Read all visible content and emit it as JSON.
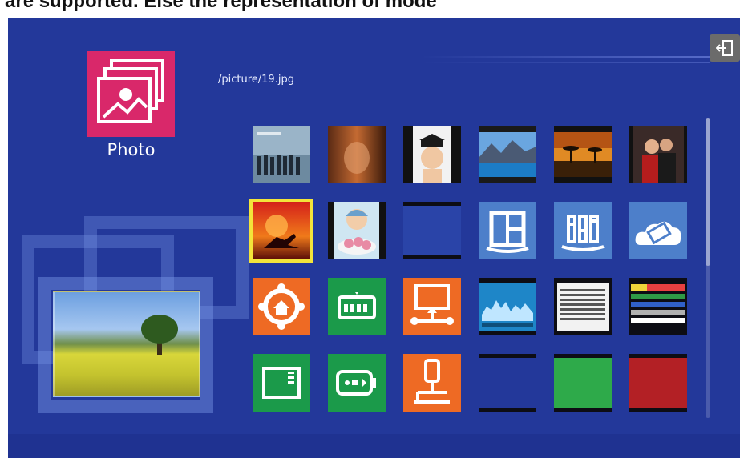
{
  "caption": "are supported. Else the representation of mode",
  "app": {
    "title": "Photo",
    "icon": "photo-gallery-icon",
    "accent": "#d9286a"
  },
  "path": "/picture/19.jpg",
  "exit_icon": "exit-icon",
  "colors": {
    "background": "#23389a",
    "orange": "#ee6a24",
    "green": "#1b9a4a",
    "tile_blue": "#4d7fca",
    "selected": "#f3e43a",
    "solid_green": "#2eaa4a",
    "solid_red": "#b32025"
  },
  "grid": {
    "rows": [
      [
        {
          "kind": "thumb",
          "name": "thumb-band-photo"
        },
        {
          "kind": "thumb",
          "name": "thumb-blurred-photo"
        },
        {
          "kind": "thumb",
          "name": "thumb-baby-photo"
        },
        {
          "kind": "thumb",
          "name": "thumb-mountain-lake-photo"
        },
        {
          "kind": "thumb",
          "name": "thumb-sunset-photo"
        },
        {
          "kind": "thumb",
          "name": "thumb-couple-photo"
        }
      ],
      [
        {
          "kind": "thumb",
          "name": "thumb-silhouette-photo",
          "selected": true
        },
        {
          "kind": "thumb",
          "name": "thumb-child-cupcakes-photo"
        },
        {
          "kind": "thumb",
          "name": "thumb-blank-photo"
        },
        {
          "kind": "icon",
          "name": "layout-app-icon",
          "color": "#4d7fca"
        },
        {
          "kind": "icon",
          "name": "equalizer-app-icon",
          "color": "#4d7fca"
        },
        {
          "kind": "icon",
          "name": "media-cloud-app-icon",
          "color": "#4d7fca"
        }
      ],
      [
        {
          "kind": "icon",
          "name": "home-network-icon",
          "color": "#ee6a24"
        },
        {
          "kind": "icon",
          "name": "memory-card-icon",
          "color": "#1b9a4a"
        },
        {
          "kind": "icon",
          "name": "network-presentation-icon",
          "color": "#ee6a24"
        },
        {
          "kind": "thumb",
          "name": "thumb-audio-waveform"
        },
        {
          "kind": "thumb",
          "name": "thumb-test-pattern"
        },
        {
          "kind": "thumb",
          "name": "thumb-color-bars"
        }
      ],
      [
        {
          "kind": "icon",
          "name": "sd-card-icon",
          "color": "#1b9a4a"
        },
        {
          "kind": "icon",
          "name": "usb-drive-icon",
          "color": "#1b9a4a"
        },
        {
          "kind": "icon",
          "name": "usb-network-icon",
          "color": "#ee6a24"
        },
        {
          "kind": "solid",
          "name": "thumb-solid-blue",
          "color": "#23389a"
        },
        {
          "kind": "solid",
          "name": "thumb-solid-green",
          "color": "#2eaa4a"
        },
        {
          "kind": "solid",
          "name": "thumb-solid-red",
          "color": "#b32025"
        }
      ]
    ]
  }
}
